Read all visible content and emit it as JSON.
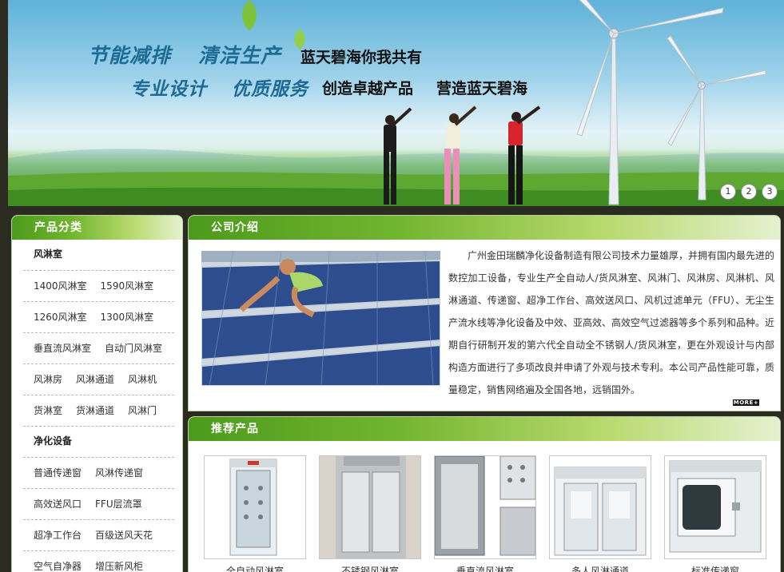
{
  "banner": {
    "slogan_1": "节能减排",
    "slogan_2": "清洁生产",
    "slogan_3": "蓝天碧海你我共有",
    "slogan_4": "专业设计",
    "slogan_5": "优质服务",
    "slogan_6": "创造卓越产品",
    "slogan_7": "营造蓝天碧海",
    "pages": [
      "1",
      "2",
      "3"
    ]
  },
  "sidebar": {
    "title": "产品分类",
    "group_1": "风淋室",
    "group_1_rows": [
      [
        "1400风淋室",
        "1590风淋室"
      ],
      [
        "1260风淋室",
        "1300风淋室"
      ],
      [
        "垂直流风淋室",
        "自动门风淋室"
      ],
      [
        "风淋房",
        "风淋通道",
        "风淋机"
      ],
      [
        "货淋室",
        "货淋通道",
        "风淋门"
      ]
    ],
    "group_2": "净化设备",
    "group_2_rows": [
      [
        "普通传递窗",
        "风淋传递窗"
      ],
      [
        "高效送风口",
        "FFU层流罩"
      ],
      [
        "超净工作台",
        "百级送风天花"
      ],
      [
        "空气自净器",
        "增压新风柜"
      ]
    ]
  },
  "about": {
    "title": "公司介绍",
    "text": "广州金田瑞麟净化设备制造有限公司技术力量雄厚，并拥有国内最先进的数控加工设备，专业生产全自动人/货风淋室、风淋门、风淋房、风淋机、风淋通道、传递窗、超净工作台、高效送风口、风机过滤单元（FFU）、无尘生产流水线等净化设备及中效、亚高效、高效空气过滤器等多个系列和品种。近期自行研制开发的第六代全自动全不锈钢人/货风淋室，更在外观设计与内部构造方面进行了多项改良并申请了外观与技术专利。本公司产品性能可靠，质量稳定，销售网络遍及全国各地，远销国外。",
    "more": "MORE+"
  },
  "products": {
    "title": "推荐产品",
    "items": [
      {
        "name": "全自动风淋室"
      },
      {
        "name": "不锈钢风淋室"
      },
      {
        "name": "垂直流风淋室"
      },
      {
        "name": "多人风淋通道"
      },
      {
        "name": "标准传递窗"
      }
    ]
  },
  "colors": {
    "header_green": "#4c9a1c",
    "slogan_blue": "#1d6b94",
    "page_bg": "#2b2b22"
  }
}
